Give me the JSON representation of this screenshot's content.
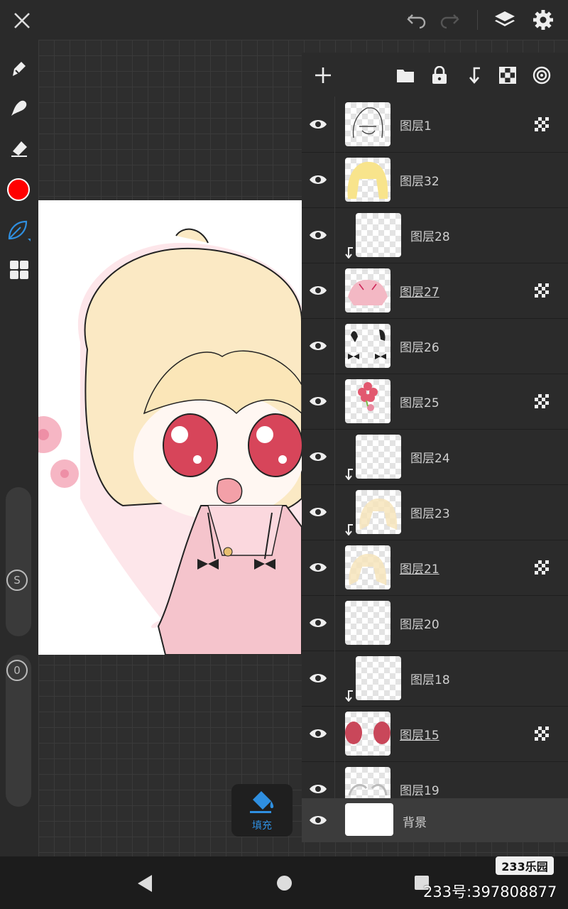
{
  "layers": [
    {
      "name": "图层1",
      "underlined": false,
      "clipped": false,
      "alpha_lock": true,
      "thumb": "sketch"
    },
    {
      "name": "图层32",
      "underlined": false,
      "clipped": false,
      "alpha_lock": false,
      "thumb": "yellow-hair"
    },
    {
      "name": "图层28",
      "underlined": false,
      "clipped": true,
      "alpha_lock": false,
      "thumb": "empty"
    },
    {
      "name": "图层27",
      "underlined": true,
      "clipped": false,
      "alpha_lock": true,
      "thumb": "pink-clothes"
    },
    {
      "name": "图层26",
      "underlined": false,
      "clipped": false,
      "alpha_lock": false,
      "thumb": "black-bows"
    },
    {
      "name": "图层25",
      "underlined": false,
      "clipped": false,
      "alpha_lock": true,
      "thumb": "flowers"
    },
    {
      "name": "图层24",
      "underlined": false,
      "clipped": true,
      "alpha_lock": false,
      "thumb": "empty"
    },
    {
      "name": "图层23",
      "underlined": false,
      "clipped": true,
      "alpha_lock": false,
      "thumb": "faint-hair"
    },
    {
      "name": "图层21",
      "underlined": true,
      "clipped": false,
      "alpha_lock": true,
      "thumb": "faint-hair"
    },
    {
      "name": "图层20",
      "underlined": false,
      "clipped": false,
      "alpha_lock": false,
      "thumb": "empty"
    },
    {
      "name": "图层18",
      "underlined": false,
      "clipped": true,
      "alpha_lock": false,
      "thumb": "empty"
    },
    {
      "name": "图层15",
      "underlined": true,
      "clipped": false,
      "alpha_lock": true,
      "thumb": "red-eyes"
    },
    {
      "name": "图层19",
      "underlined": false,
      "clipped": false,
      "alpha_lock": false,
      "thumb": "grey"
    }
  ],
  "background_layer": {
    "name": "背景"
  },
  "fill_tool": {
    "label": "填充"
  },
  "watermark": {
    "logo": "233乐园",
    "text": "233号:397808877"
  },
  "side_sliders": {
    "size_label": "S",
    "opacity_label": "0"
  },
  "colors": {
    "current_color": "#ff0000",
    "accent": "#2f8fe0"
  },
  "icons": {
    "top": [
      "close-icon",
      "undo-icon",
      "redo-icon",
      "layers-icon",
      "settings-icon"
    ],
    "tools": [
      "pen-icon",
      "smudge-icon",
      "eraser-icon",
      "color-swatch",
      "brush-icon",
      "grid-icon"
    ],
    "layer_toolbar": [
      "add-icon",
      "folder-icon",
      "lock-icon",
      "clip-icon",
      "transparency-icon",
      "blend-mode-icon"
    ]
  }
}
